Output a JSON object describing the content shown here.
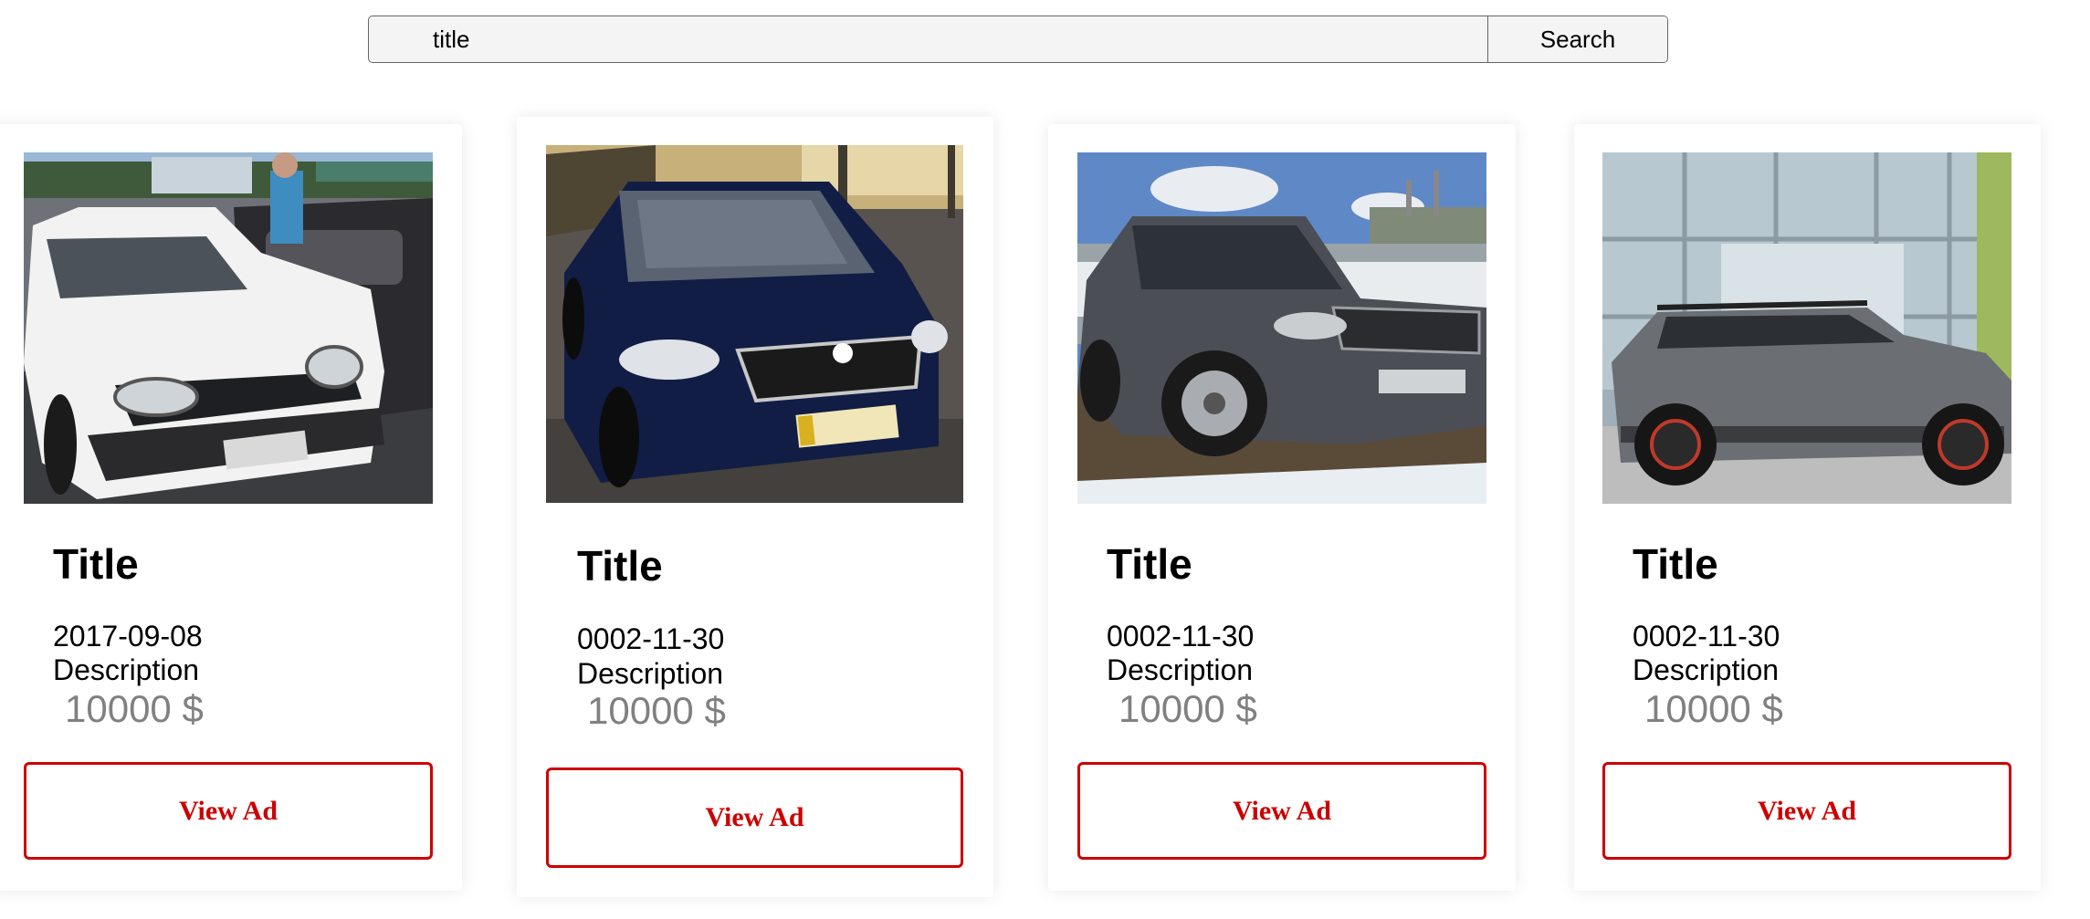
{
  "search": {
    "value": "title",
    "button_label": "Search"
  },
  "cards": [
    {
      "image": "white-toyota-sedan-photo",
      "title": "Title",
      "date": "2017-09-08",
      "description": "Description",
      "price": "10000 $",
      "button_label": "View Ad"
    },
    {
      "image": "dark-blue-skoda-rapid-photo",
      "title": "Title",
      "date": "0002-11-30",
      "description": "Description",
      "price": "10000 $",
      "button_label": "View Ad"
    },
    {
      "image": "grey-geely-suv-photo",
      "title": "Title",
      "date": "0002-11-30",
      "description": "Description",
      "price": "10000 $",
      "button_label": "View Ad"
    },
    {
      "image": "grey-renault-duster-photo",
      "title": "Title",
      "date": "0002-11-30",
      "description": "Description",
      "price": "10000 $",
      "button_label": "View Ad"
    }
  ],
  "colors": {
    "button_accent": "#cc0000",
    "price_text": "#808080",
    "search_background": "#f4f4f4"
  }
}
